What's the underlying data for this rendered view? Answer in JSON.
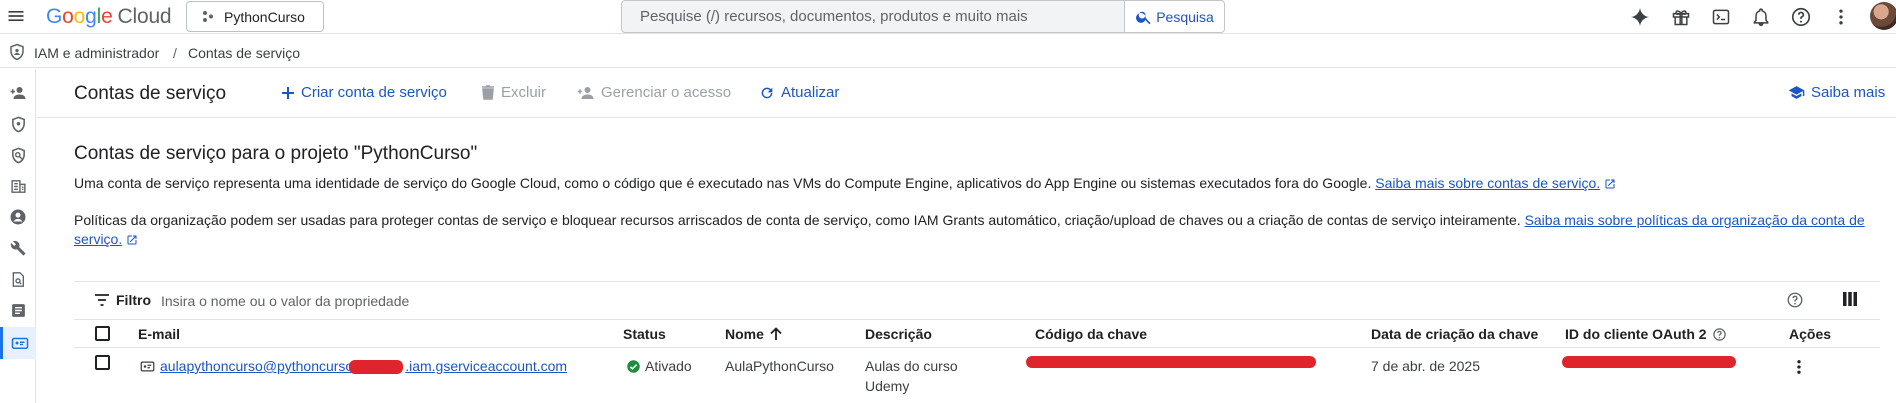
{
  "topbar": {
    "logo_google": "Google",
    "logo_cloud": "Cloud",
    "project": "PythonCurso",
    "search_placeholder": "Pesquise (/) recursos, documentos, produtos e muito mais",
    "search_button": "Pesquisa",
    "icons": [
      "gemini-icon",
      "gift-icon",
      "terminal-icon",
      "bell-icon",
      "help-icon",
      "more-vert-icon"
    ]
  },
  "breadcrumb": {
    "section": "IAM e administrador",
    "separator": "/",
    "page": "Contas de serviço"
  },
  "rail": {
    "icons": [
      "person-add-icon",
      "shield-icon",
      "policy-icon",
      "org-icon",
      "account-icon",
      "wrench-icon",
      "audit-icon",
      "list-icon",
      "service-account-icon"
    ]
  },
  "header": {
    "title": "Contas de serviço",
    "actions": {
      "create": "Criar conta de serviço",
      "delete": "Excluir",
      "manage": "Gerenciar o acesso",
      "refresh": "Atualizar"
    },
    "learn_more": "Saiba mais"
  },
  "main": {
    "heading": "Contas de serviço para o projeto \"PythonCurso\"",
    "desc1": "Uma conta de serviço representa uma identidade de serviço do Google Cloud, como o código que é executado nas VMs do Compute Engine, aplicativos do App Engine ou sistemas executados fora do Google.",
    "desc1_link": "Saiba mais sobre contas de serviço.",
    "desc2": "Políticas da organização podem ser usadas para proteger contas de serviço e bloquear recursos arriscados de conta de serviço, como IAM Grants automático, criação/upload de chaves ou a criação de contas de serviço inteiramente.",
    "desc2_link_a": "Saiba mais sobre políticas da organização da conta de",
    "desc2_link_b": "serviço."
  },
  "filter": {
    "label": "Filtro",
    "placeholder": "Insira o nome ou o valor da propriedade"
  },
  "table": {
    "columns": {
      "email": "E-mail",
      "status": "Status",
      "name": "Nome",
      "description": "Descrição",
      "key_id": "Código da chave",
      "created": "Data de criação da chave",
      "oauth": "ID do cliente OAuth 2",
      "actions": "Ações"
    },
    "rows": [
      {
        "email_prefix": "aulapythoncurso@pythoncurso",
        "email_suffix": ".iam.gserviceaccount.com",
        "status": "Ativado",
        "name": "AulaPythonCurso",
        "description_1": "Aulas do curso",
        "description_2": "Udemy",
        "created": "7 de abr. de 2025"
      }
    ]
  },
  "colors": {
    "accent": "#1a56c4",
    "active_rail": "#e8f0fe",
    "status_ok": "#1e8e3e",
    "redaction": "#e0242b"
  }
}
